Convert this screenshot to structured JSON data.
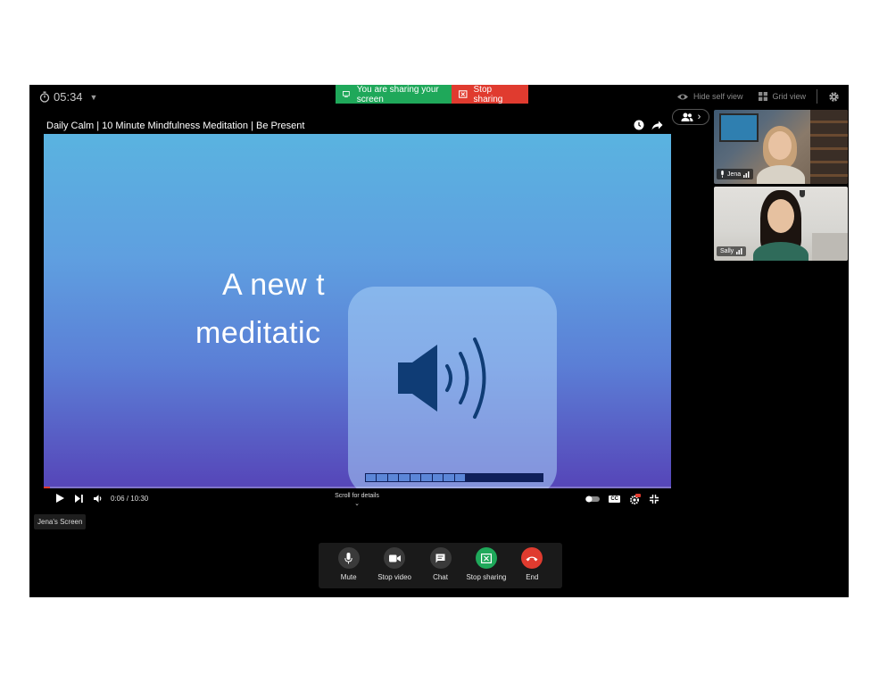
{
  "timer": {
    "value": "05:34"
  },
  "share_banner": {
    "sharing_text": "You are sharing your screen",
    "stop_text": "Stop sharing"
  },
  "top_right": {
    "hide_self_view": "Hide self view",
    "grid_view": "Grid view"
  },
  "video": {
    "title": "Daily Calm | 10 Minute Mindfulness Meditation | Be Present",
    "line1": "A new t",
    "line2": "meditatic",
    "time": "0:06 / 10:30",
    "scroll_hint": "Scroll for details",
    "cc_badge": "CC",
    "playback_progress": 0.01,
    "volume_level": 0.55,
    "volume_segments": 16
  },
  "screen_label": "Jena's Screen",
  "participants": [
    {
      "name": "Jena"
    },
    {
      "name": "Sally"
    }
  ],
  "toolbar": {
    "mute": "Mute",
    "stop_video": "Stop video",
    "chat": "Chat",
    "stop_sharing": "Stop sharing",
    "end": "End"
  },
  "colors": {
    "share_green": "#1fa85a",
    "stop_red": "#e03b2f",
    "end_red": "#e03b2f",
    "volume_fill": "#5b86d8",
    "volume_track": "#0f1f5a"
  },
  "icons": [
    "stopwatch-icon",
    "screen-icon",
    "stop-share-icon",
    "eye-icon",
    "grid-icon",
    "gear-icon",
    "clock-icon",
    "share-arrow-icon",
    "people-icon",
    "chevron-right-icon",
    "play-icon",
    "next-icon",
    "volume-icon",
    "speaker-icon",
    "toggle-icon",
    "settings-hd-icon",
    "exit-fullscreen-icon",
    "mic-icon",
    "camera-icon",
    "chat-icon",
    "phone-end-icon",
    "signal-icon"
  ]
}
